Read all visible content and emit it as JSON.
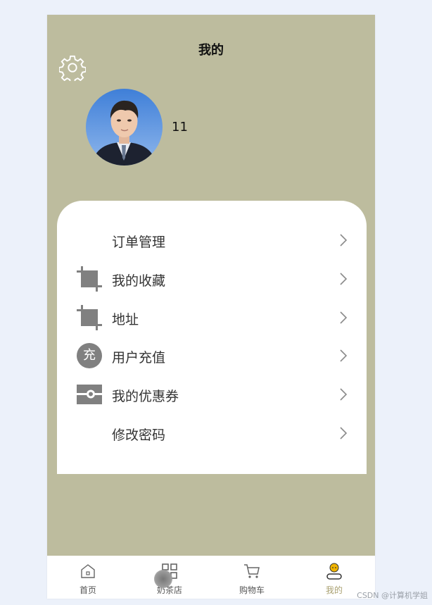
{
  "header": {
    "title": "我的"
  },
  "profile": {
    "username": "11"
  },
  "menu": [
    {
      "label": "订单管理",
      "icon": "none"
    },
    {
      "label": "我的收藏",
      "icon": "crop-icon"
    },
    {
      "label": "地址",
      "icon": "crop-icon"
    },
    {
      "label": "用户充值",
      "icon": "recharge-icon",
      "icon_text": "充"
    },
    {
      "label": "我的优惠券",
      "icon": "coupon-icon"
    },
    {
      "label": "修改密码",
      "icon": "none"
    }
  ],
  "tabbar": [
    {
      "label": "首页",
      "icon": "home-icon"
    },
    {
      "label": "奶茶店",
      "icon": "grid-icon"
    },
    {
      "label": "购物车",
      "icon": "cart-icon"
    },
    {
      "label": "我的",
      "icon": "profile-icon",
      "active": true
    }
  ],
  "colors": {
    "header_bg": "#bdbc9e",
    "active_tab": "#a9a070",
    "icon_gray": "#808080"
  },
  "watermark": "CSDN @计算机学姐"
}
